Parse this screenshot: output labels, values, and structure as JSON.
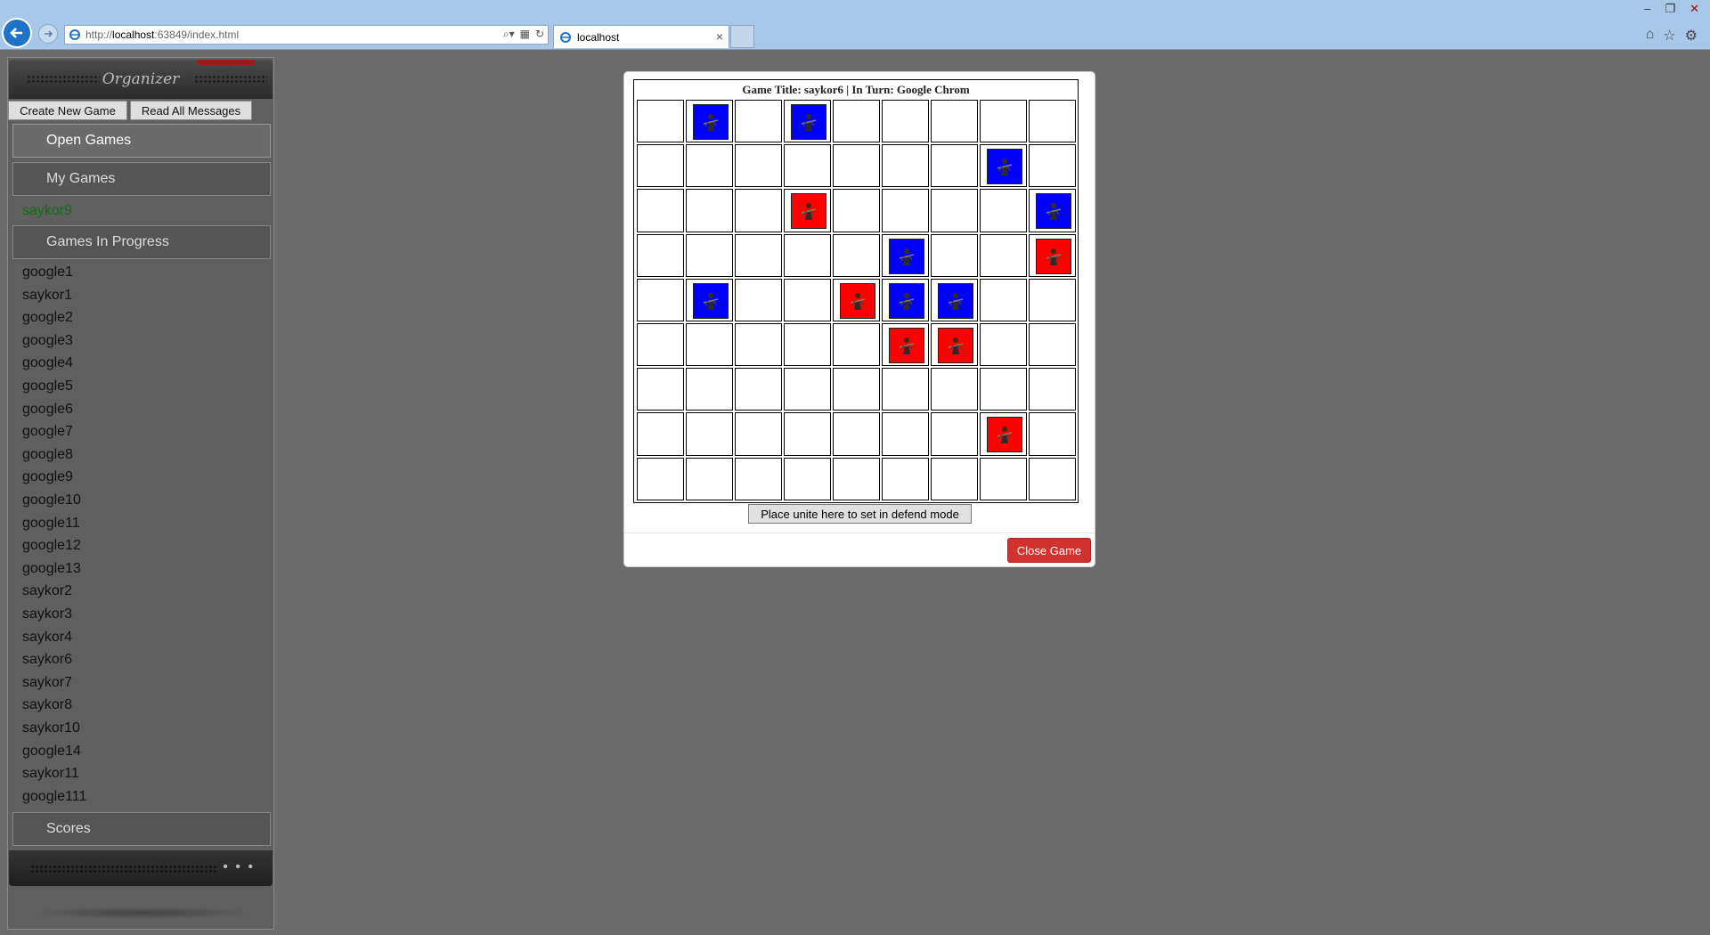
{
  "browser": {
    "url_prefix": "http://",
    "url_host": "localhost",
    "url_rest": ":63849/index.html",
    "tab_title": "localhost",
    "accent": "#1f73c7"
  },
  "sidebar": {
    "title": "Organizer",
    "create_new_game": "Create New Game",
    "read_all_messages": "Read All Messages",
    "open_games": "Open Games",
    "my_games": "My Games",
    "my_games_items": [
      "saykor9"
    ],
    "games_in_progress": "Games In Progress",
    "in_progress_items": [
      "google1",
      "saykor1",
      "google2",
      "google3",
      "google4",
      "google5",
      "google6",
      "google7",
      "google8",
      "google9",
      "google10",
      "google11",
      "google12",
      "google13",
      "saykor2",
      "saykor3",
      "saykor4",
      "saykor6",
      "saykor7",
      "saykor8",
      "saykor10",
      "google14",
      "saykor11",
      "google111"
    ],
    "scores": "Scores",
    "more": "• • •"
  },
  "modal": {
    "board_title": "Game Title: saykor6 | In Turn: Google Chrom",
    "defend_button": "Place unite here to set in defend mode",
    "close_button": "Close Game",
    "close_color": "#d2322d"
  },
  "board": {
    "rows": 9,
    "cols": 9,
    "team_colors": {
      "blue": "#0000ff",
      "red": "#ff0000"
    },
    "units": [
      {
        "row": 0,
        "col": 1,
        "team": "blue"
      },
      {
        "row": 0,
        "col": 3,
        "team": "blue"
      },
      {
        "row": 1,
        "col": 7,
        "team": "blue"
      },
      {
        "row": 2,
        "col": 3,
        "team": "red"
      },
      {
        "row": 2,
        "col": 8,
        "team": "blue"
      },
      {
        "row": 3,
        "col": 5,
        "team": "blue"
      },
      {
        "row": 3,
        "col": 8,
        "team": "red"
      },
      {
        "row": 4,
        "col": 1,
        "team": "blue"
      },
      {
        "row": 4,
        "col": 4,
        "team": "red"
      },
      {
        "row": 4,
        "col": 5,
        "team": "blue"
      },
      {
        "row": 4,
        "col": 6,
        "team": "blue"
      },
      {
        "row": 5,
        "col": 5,
        "team": "red"
      },
      {
        "row": 5,
        "col": 6,
        "team": "red"
      },
      {
        "row": 7,
        "col": 7,
        "team": "red"
      }
    ]
  }
}
